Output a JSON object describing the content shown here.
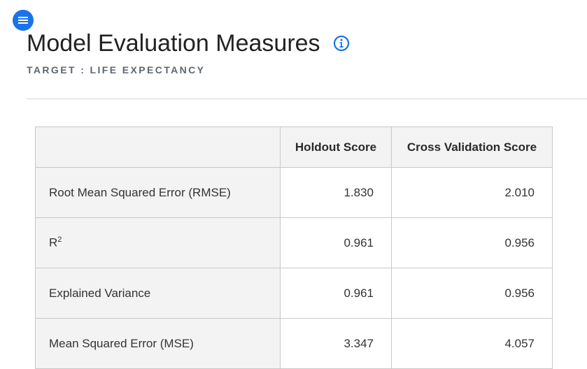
{
  "header": {
    "title": "Model Evaluation Measures",
    "subtitle": "TARGET : LIFE EXPECTANCY",
    "menu_icon": "hamburger-menu-icon",
    "info_icon": "info-icon",
    "accent_color": "#1a73e8"
  },
  "table": {
    "columns": [
      "",
      "Holdout Score",
      "Cross Validation Score"
    ],
    "rows": [
      {
        "metric": "Root Mean Squared Error (RMSE)",
        "holdout": "1.830",
        "cv": "2.010"
      },
      {
        "metric": "R",
        "metric_sup": "2",
        "holdout": "0.961",
        "cv": "0.956"
      },
      {
        "metric": "Explained Variance",
        "holdout": "0.961",
        "cv": "0.956"
      },
      {
        "metric": "Mean Squared Error (MSE)",
        "holdout": "3.347",
        "cv": "4.057"
      }
    ]
  }
}
